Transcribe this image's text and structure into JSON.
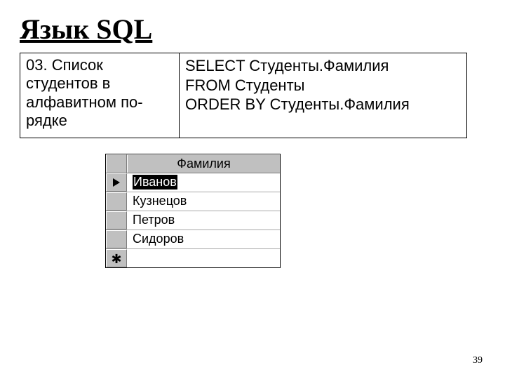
{
  "title": "Язык SQL",
  "qa": {
    "question": "03. Список студентов в алфавитном по-рядке",
    "sql_lines": [
      "SELECT Студенты.Фамилия",
      "FROM Студенты",
      "ORDER BY Студенты.Фамилия"
    ]
  },
  "grid": {
    "column_header": "Фамилия",
    "rows": [
      {
        "marker": "current",
        "value": "Иванов",
        "highlighted": true
      },
      {
        "marker": "",
        "value": "Кузнецов",
        "highlighted": false
      },
      {
        "marker": "",
        "value": "Петров",
        "highlighted": false
      },
      {
        "marker": "",
        "value": "Сидоров",
        "highlighted": false
      },
      {
        "marker": "new",
        "value": "",
        "highlighted": false
      }
    ]
  },
  "page_number": "39"
}
